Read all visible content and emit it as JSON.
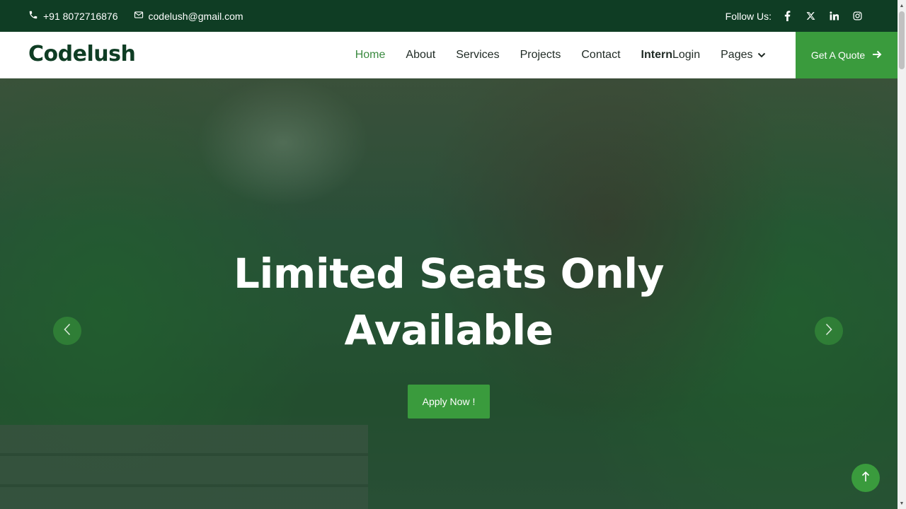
{
  "topbar": {
    "phone": "+91 8072716876",
    "email": "codelush@gmail.com",
    "follow_label": "Follow Us:",
    "socials": [
      "facebook-icon",
      "x-icon",
      "linkedin-icon",
      "instagram-icon"
    ]
  },
  "navbar": {
    "logo": "Codelush",
    "items": [
      {
        "label": "Home",
        "active": true
      },
      {
        "label": "About"
      },
      {
        "label": "Services"
      },
      {
        "label": "Projects"
      },
      {
        "label": "Contact"
      },
      {
        "label_strong": "Intern",
        "label_rest": "Login"
      },
      {
        "label": "Pages"
      }
    ],
    "quote_button": "Get A Quote"
  },
  "hero": {
    "title_line1": "Limited Seats Only",
    "title_line2": "Available",
    "apply_button": "Apply Now !"
  },
  "colors": {
    "topbar_bg": "#0f3d24",
    "accent_green": "#3a9b3d",
    "logo_color": "#0f3d24",
    "active_nav": "#3a8a3f"
  }
}
